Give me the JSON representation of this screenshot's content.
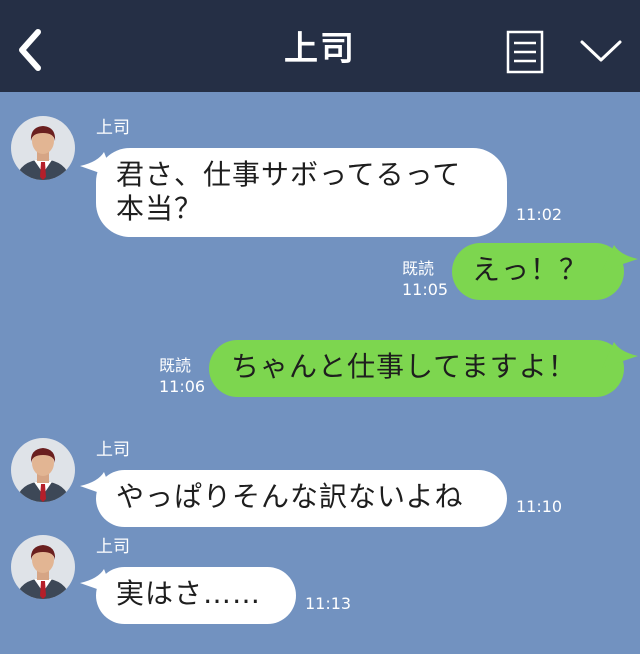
{
  "header": {
    "title": "上司"
  },
  "colors": {
    "header_bg": "#252f45",
    "chat_bg": "#7292c0",
    "incoming_bubble": "#ffffff",
    "outgoing_bubble": "#7dd64f"
  },
  "icons": [
    "back-chevron-icon",
    "menu-list-icon",
    "chevron-down-icon",
    "avatar-person-icon"
  ],
  "messages": [
    {
      "direction": "incoming",
      "sender": "上司",
      "lines": [
        "君さ、仕事サボってるって",
        "本当？"
      ],
      "time": "11:02"
    },
    {
      "direction": "outgoing",
      "read": "既読",
      "text": "えっ！？",
      "time": "11:05"
    },
    {
      "direction": "outgoing",
      "read": "既読",
      "text": "ちゃんと仕事してますよ！",
      "time": "11:06"
    },
    {
      "direction": "incoming",
      "sender": "上司",
      "text": "やっぱりそんな訳ないよね",
      "time": "11:10"
    },
    {
      "direction": "incoming",
      "sender": "上司",
      "text": "実はさ……",
      "time": "11:13"
    }
  ]
}
